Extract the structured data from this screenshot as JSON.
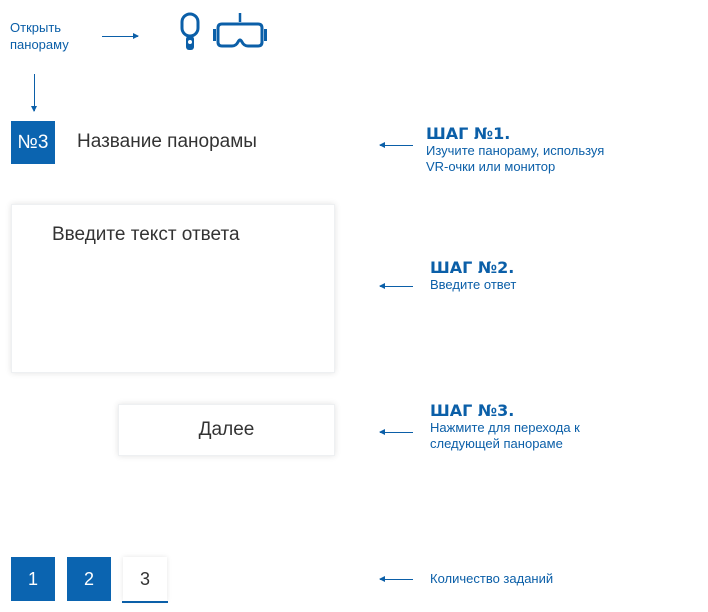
{
  "open_panorama": {
    "label": "Открыть панораму"
  },
  "task": {
    "number": "№3",
    "title": "Название панорамы"
  },
  "answer": {
    "placeholder": "Введите текст ответа"
  },
  "next_button": {
    "label": "Далее"
  },
  "steps": [
    {
      "title": "ШАГ №1.",
      "lines": [
        "Изучите панораму, используя",
        "VR-очки или монитор"
      ]
    },
    {
      "title": "ШАГ №2.",
      "lines": [
        "Введите ответ"
      ]
    },
    {
      "title": "ШАГ №3.",
      "lines": [
        "Нажмите для перехода к",
        "следующей панораме"
      ]
    }
  ],
  "pagination": {
    "pages": [
      "1",
      "2",
      "3"
    ],
    "current": "3",
    "caption": "Количество заданий"
  },
  "colors": {
    "accent": "#0b64b0",
    "text": "#333333"
  },
  "icons": [
    "vr-controller-icon",
    "vr-headset-icon"
  ]
}
